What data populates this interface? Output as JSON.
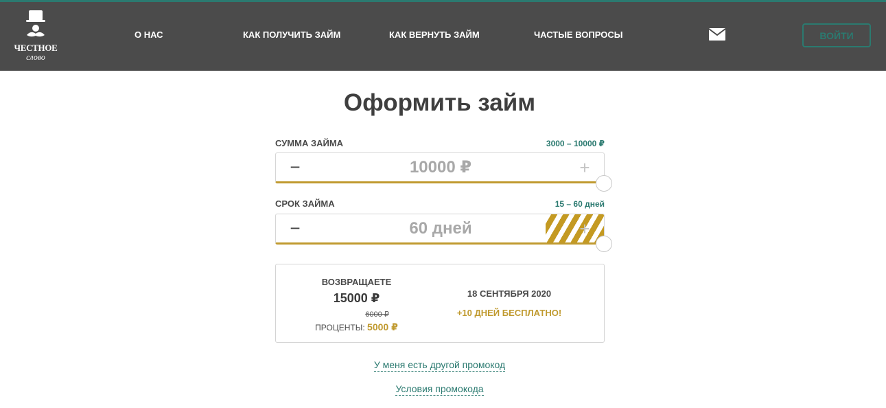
{
  "brand": {
    "name": "ЧЕСТНОЕ",
    "subname": "слово"
  },
  "nav": {
    "items": [
      "О НАС",
      "КАК ПОЛУЧИТЬ ЗАЙМ",
      "КАК ВЕРНУТЬ ЗАЙМ",
      "ЧАСТЫЕ ВОПРОСЫ"
    ],
    "mail_icon": "envelope-icon",
    "login_label": "ВОЙТИ"
  },
  "colors": {
    "accent": "#2b7a70",
    "gold": "#c09a2f",
    "header_bg": "#4b4b4b"
  },
  "form": {
    "title": "Оформить займ",
    "amount": {
      "label": "СУММА ЗАЙМА",
      "range": "3000 – 10000 ₽",
      "value": "10000 ₽",
      "minus": "−",
      "plus": "+"
    },
    "term": {
      "label": "СРОК ЗАЙМА",
      "range": "15 – 60 дней",
      "value": "60 дней",
      "minus": "−",
      "plus": "+"
    }
  },
  "summary": {
    "return_label": "ВОЗВРАЩАЕТЕ",
    "return_amount": "15000 ₽",
    "old_interest": "6000 ₽",
    "interest_label": "ПРОЦЕНТЫ:",
    "interest_value": "5000 ₽",
    "date": "18 СЕНТЯБРЯ 2020",
    "bonus": "+10 ДНЕЙ БЕСПЛАТНО!"
  },
  "promo": {
    "other_code": "У меня есть другой промокод",
    "conditions": "Условия промокода"
  }
}
